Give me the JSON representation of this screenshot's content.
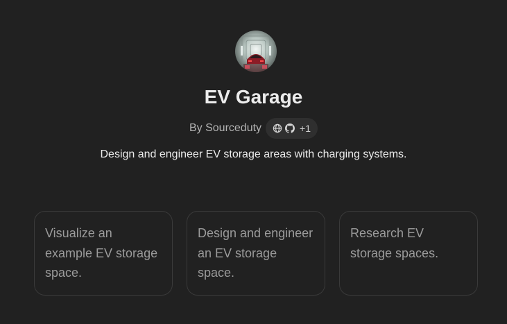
{
  "gpt": {
    "name": "EV Garage",
    "author": "By Sourceduty",
    "social_more": "+1",
    "description": "Design and engineer EV storage areas with charging systems."
  },
  "icons": {
    "avatar": "ev-garage-avatar-image",
    "web": "globe-icon",
    "github": "github-icon"
  },
  "conversation_starters": [
    {
      "label": "Visualize an example EV storage space."
    },
    {
      "label": "Design and engineer an EV storage space."
    },
    {
      "label": "Research EV storage spaces."
    }
  ],
  "colors": {
    "background": "#212121",
    "card_border": "#3a3a3a",
    "pill_background": "#2f2f2f",
    "text_primary": "#ececec",
    "text_muted": "#9b9b9b"
  }
}
